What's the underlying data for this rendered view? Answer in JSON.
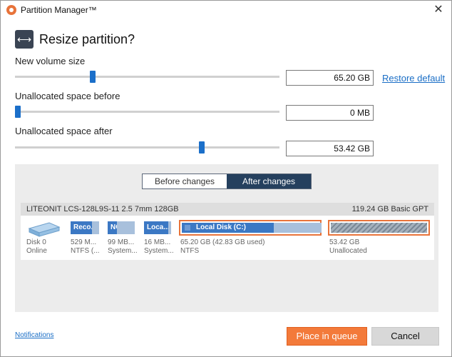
{
  "window": {
    "title": "Partition Manager™",
    "close_glyph": "✕"
  },
  "header": {
    "title": "Resize partition?",
    "icon": "resize-arrows-icon"
  },
  "sliders": [
    {
      "label": "New volume size",
      "value": "65.20 GB",
      "position": 0.29
    },
    {
      "label": "Unallocated space before",
      "value": "0 MB",
      "position": 0.0
    },
    {
      "label": "Unallocated space after",
      "value": "53.42 GB",
      "position": 0.71
    }
  ],
  "restore_default": "Restore default",
  "view_toggle": {
    "before": "Before changes",
    "after": "After changes",
    "selected": "after"
  },
  "disk": {
    "name": "LITEONIT LCS-128L9S-11 2.5 7mm 128GB",
    "info": "119.24 GB Basic GPT",
    "icon_label": "Disk 0",
    "status": "Online",
    "partitions": [
      {
        "label": "Reco...",
        "size": "529 M...",
        "type": "NTFS (...",
        "used": 0.75
      },
      {
        "label": "NO ...",
        "size": "99 MB...",
        "type": "System...",
        "used": 0.35
      },
      {
        "label": "Loca...",
        "size": "16 MB...",
        "type": "System...",
        "used": 0.9
      },
      {
        "label": "Local Disk (C:)",
        "size": "65.20 GB (42.83 GB used)",
        "type": "NTFS",
        "used": 0.66
      },
      {
        "label": "",
        "size": "53.42 GB",
        "type": "Unallocated",
        "used": 0
      }
    ]
  },
  "footer": {
    "notifications": "Notifications",
    "queue_button": "Place in queue",
    "cancel_button": "Cancel"
  },
  "colors": {
    "accent": "#f37a3a",
    "partition_blue": "#3b78c4",
    "slider_blue": "#1b6fc9",
    "toggle_dark": "#25405e"
  }
}
